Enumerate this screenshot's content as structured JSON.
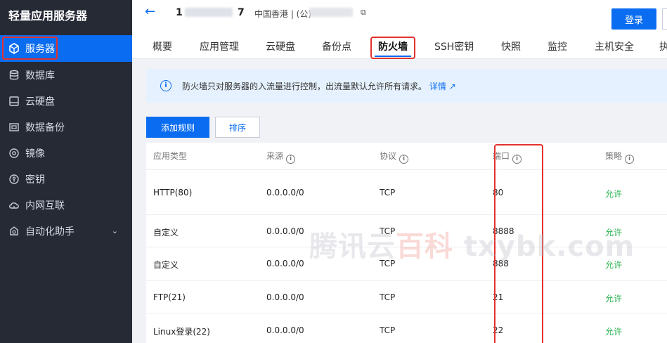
{
  "sidebar": {
    "brand": "轻量应用服务器",
    "items": [
      {
        "label": "服务器",
        "icon": "cube-icon",
        "active": true
      },
      {
        "label": "数据库",
        "icon": "database-icon"
      },
      {
        "label": "云硬盘",
        "icon": "disk-icon"
      },
      {
        "label": "数据备份",
        "icon": "backup-icon"
      },
      {
        "label": "镜像",
        "icon": "image-icon"
      },
      {
        "label": "密钥",
        "icon": "key-icon"
      },
      {
        "label": "内网互联",
        "icon": "cloud-link-icon"
      },
      {
        "label": "自动化助手",
        "icon": "gear-icon",
        "expandable": true
      }
    ]
  },
  "header": {
    "back_icon": "←",
    "instance_prefix": "1",
    "instance_suffix": "7",
    "instance_region": "中国香港 | (公)",
    "login_label": "登录"
  },
  "tabs": [
    {
      "label": "概要"
    },
    {
      "label": "应用管理"
    },
    {
      "label": "云硬盘"
    },
    {
      "label": "备份点"
    },
    {
      "label": "防火墙",
      "active": true
    },
    {
      "label": "SSH密钥"
    },
    {
      "label": "快照"
    },
    {
      "label": "监控"
    },
    {
      "label": "主机安全"
    },
    {
      "label": "执"
    }
  ],
  "notice": {
    "text": "防火墙只对服务器的入流量进行控制，出流量默认允许所有请求。",
    "link": "详情"
  },
  "actions": {
    "add_rule": "添加规则",
    "sort": "排序"
  },
  "table": {
    "headers": [
      "应用类型",
      "来源",
      "协议",
      "端口",
      "策略"
    ],
    "rows": [
      {
        "type": "HTTP(80)",
        "source": "0.0.0.0/0",
        "protocol": "TCP",
        "port": "80",
        "policy": "允许"
      },
      {
        "type": "自定义",
        "source": "0.0.0.0/0",
        "protocol": "TCP",
        "port": "8888",
        "policy": "允许"
      },
      {
        "type": "自定义",
        "source": "0.0.0.0/0",
        "protocol": "TCP",
        "port": "888",
        "policy": "允许"
      },
      {
        "type": "FTP(21)",
        "source": "0.0.0.0/0",
        "protocol": "TCP",
        "port": "21",
        "policy": "允许"
      },
      {
        "type": "Linux登录(22)",
        "source": "0.0.0.0/0",
        "protocol": "TCP",
        "port": "22",
        "policy": "允许"
      }
    ]
  },
  "watermark": {
    "part1": "腾讯云",
    "part2": "百科",
    "part3": " txybk.com"
  },
  "colors": {
    "primary": "#0a6cf0",
    "sidebar": "#262a35",
    "highlight": "#e4312d",
    "allow": "#29b34f"
  }
}
